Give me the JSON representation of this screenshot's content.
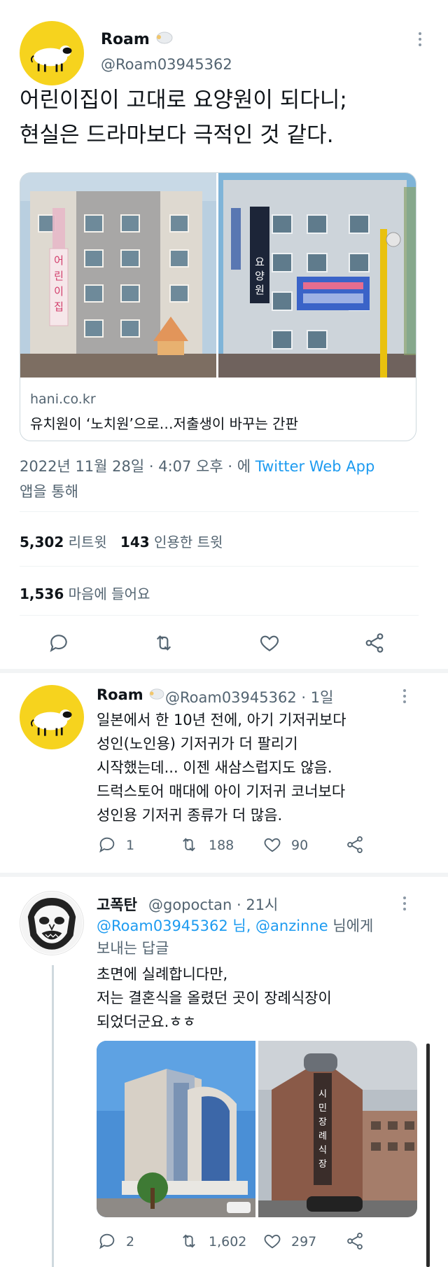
{
  "main_tweet": {
    "author": {
      "name": "Roam",
      "handle": "@Roam03945362"
    },
    "text_lines": [
      "어린이집이 고대로 요양원이 되다니;",
      "현실은 드라마보다 극적인 것 같다."
    ],
    "card": {
      "domain": "hani.co.kr",
      "title": "유치원이 ‘노치원’으로…저출생이 바꾸는 간판",
      "left_sign": "어린이집",
      "right_sign": "요양원"
    },
    "meta": {
      "date": "2022년 11월 28일 · 4:07 오후 · 에",
      "app": "Twitter Web App",
      "via": "앱을 통해"
    },
    "stats": {
      "retweets": "5,302",
      "retweets_label": "리트윗",
      "quotes": "143",
      "quotes_label": "인용한 트윗",
      "likes": "1,536",
      "likes_label": "마음에 들어요"
    }
  },
  "reply1": {
    "name": "Roam",
    "handle_time": "@Roam03945362 · 1일",
    "text_lines": [
      "일본에서 한 10년 전에, 아기 기저귀보다",
      "성인(노인용) 기저귀가 더 팔리기",
      "시작했는데... 이젠 새삼스럽지도 않음.",
      "드럭스토어 매대에 아이 기저귀 코너보다",
      "성인용 기저귀 종류가 더 많음."
    ],
    "replies": "1",
    "retweets": "188",
    "likes": "90"
  },
  "reply2": {
    "name": "고폭탄",
    "handle_time": "@gopoctan · 21시",
    "reply_to_mentions": "@Roam03945362 님, @anzinne",
    "reply_to_suffix": " 님에게",
    "reply_to_line2": "보내는 답글",
    "text_lines": [
      "초면에 실례합니다만,",
      "저는 결혼식을 올렸던 곳이 장례식장이",
      "되었더군요.ㅎㅎ"
    ],
    "right_photo_sign": "시민장례식장",
    "replies": "2",
    "retweets": "1,602",
    "likes": "297"
  },
  "colors": {
    "accent": "#1d9bf0",
    "muted": "#536471",
    "avatar_yellow": "#f6d31e"
  }
}
